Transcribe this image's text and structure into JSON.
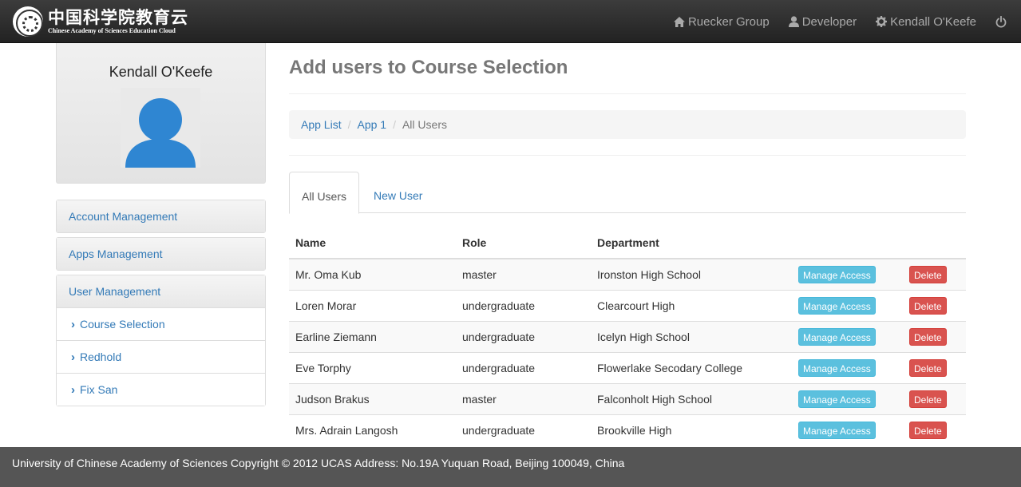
{
  "brand": {
    "name_cn": "中国科学院教育云",
    "name_en": "Chinese Academy of Sciences Education Cloud"
  },
  "navbar": {
    "group": "Ruecker Group",
    "role": "Developer",
    "user": "Kendall O'Keefe"
  },
  "profile": {
    "name": "Kendall O'Keefe"
  },
  "sidebar": {
    "account": "Account Management",
    "apps": "Apps Management",
    "users": "User Management",
    "sub_items": [
      "Course Selection",
      "Redhold",
      "Fix San"
    ]
  },
  "main": {
    "title": "Add users to Course Selection",
    "breadcrumb": [
      "App List",
      "App 1",
      "All Users"
    ],
    "tabs": [
      "All Users",
      "New User"
    ],
    "columns": [
      "Name",
      "Role",
      "Department"
    ],
    "manage_label": "Manage Access",
    "delete_label": "Delete",
    "rows": [
      {
        "name": "Mr. Oma Kub",
        "role": "master",
        "department": "Ironston High School"
      },
      {
        "name": "Loren Morar",
        "role": "undergraduate",
        "department": "Clearcourt High"
      },
      {
        "name": "Earline Ziemann",
        "role": "undergraduate",
        "department": "Icelyn High School"
      },
      {
        "name": "Eve Torphy",
        "role": "undergraduate",
        "department": "Flowerlake Secodary College"
      },
      {
        "name": "Judson Brakus",
        "role": "master",
        "department": "Falconholt High School"
      },
      {
        "name": "Mrs. Adrain Langosh",
        "role": "undergraduate",
        "department": "Brookville High"
      }
    ]
  },
  "footer": {
    "text": "University of Chinese Academy of Sciences Copyright © 2012 UCAS Address: No.19A Yuquan Road, Beijing 100049, China"
  },
  "colors": {
    "link": "#337ab7",
    "info": "#5bc0de",
    "danger": "#d9534f",
    "avatar": "#2f86d2"
  }
}
